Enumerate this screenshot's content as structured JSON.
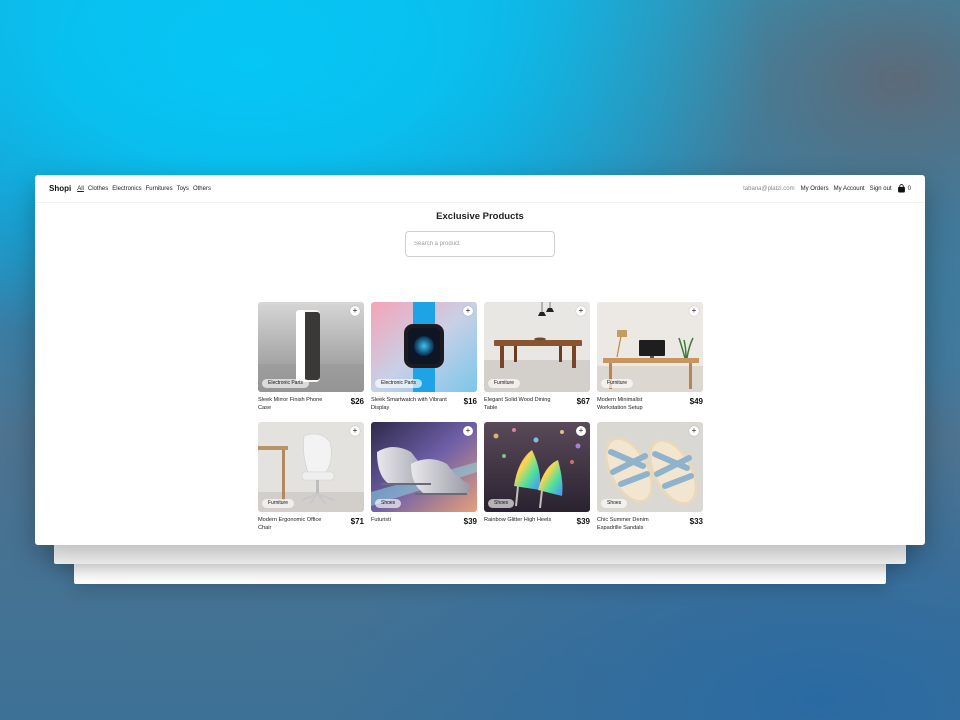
{
  "nav": {
    "brand": "Shopi",
    "categories": [
      "All",
      "Clothes",
      "Electronics",
      "Furnitures",
      "Toys",
      "Others"
    ],
    "email": "tabana@platzi.com",
    "my_orders": "My Orders",
    "my_account": "My Account",
    "sign_out": "Sign out",
    "cart_count": "0"
  },
  "main": {
    "title": "Exclusive Products",
    "search_placeholder": "Search a product"
  },
  "products": [
    {
      "name": "Sleek Mirror Finish Phone Case",
      "price": "$26",
      "category": "Electronic Parts",
      "icon": "phone-case-image"
    },
    {
      "name": "Sleek Smartwatch with Vibrant Display",
      "price": "$16",
      "category": "Electronic Parts",
      "icon": "smartwatch-image"
    },
    {
      "name": "Elegant Solid Wood Dining Table",
      "price": "$67",
      "category": "Furniture",
      "icon": "dining-table-image"
    },
    {
      "name": "Modern Minimalist Workstation Setup",
      "price": "$49",
      "category": "Furniture",
      "icon": "workstation-image"
    },
    {
      "name": "Modern Ergonomic Office Chair",
      "price": "$71",
      "category": "Furniture",
      "icon": "office-chair-image"
    },
    {
      "name": "Futuristi",
      "price": "$39",
      "category": "Shoes",
      "icon": "silver-sneakers-image"
    },
    {
      "name": "Rainbow Glitter High Heels",
      "price": "$39",
      "category": "Shoes",
      "icon": "glitter-heels-image"
    },
    {
      "name": "Chic Summer Denim Espadrille Sandals",
      "price": "$33",
      "category": "Shoes",
      "icon": "denim-sandals-image"
    }
  ],
  "ui": {
    "add_symbol": "+"
  }
}
